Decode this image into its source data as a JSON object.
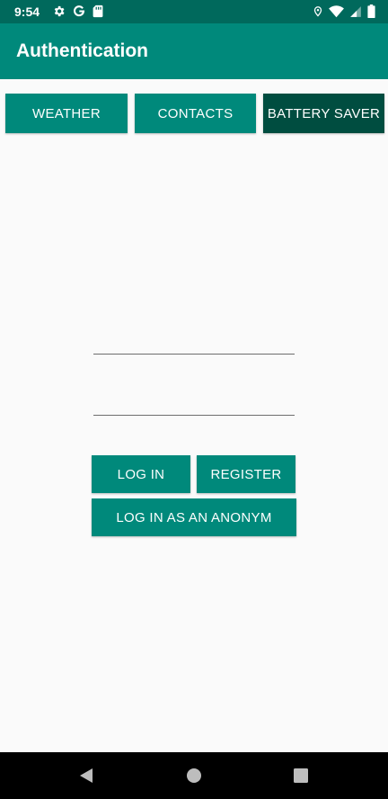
{
  "status_bar": {
    "time": "9:54",
    "left_icons": [
      "settings-icon",
      "google-icon",
      "sd-card-icon"
    ],
    "right_icons": [
      "location-icon",
      "wifi-icon",
      "signal-icon",
      "battery-icon"
    ]
  },
  "app_bar": {
    "title": "Authentication"
  },
  "tabs": [
    {
      "label": "WEATHER"
    },
    {
      "label": "CONTACTS"
    },
    {
      "label": "BATTERY SAVER"
    }
  ],
  "form": {
    "username_value": "",
    "password_value": "",
    "login_label": "LOG IN",
    "register_label": "REGISTER",
    "anonymous_label": "LOG IN AS AN ANONYM"
  },
  "colors": {
    "status_bar": "#00695c",
    "app_bar": "#00897b",
    "button": "#00897b",
    "button_selected": "#004d40",
    "background": "#fafafa"
  },
  "nav_bar": {
    "icons": [
      "back-icon",
      "home-icon",
      "recents-icon"
    ]
  }
}
